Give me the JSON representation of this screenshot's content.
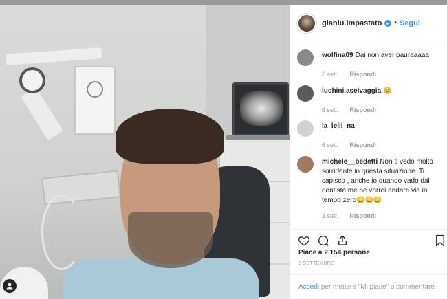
{
  "post": {
    "owner": "gianlu.impastato",
    "separator": "•",
    "follow_label": "Segui"
  },
  "comments": [
    {
      "user": "wolfina09",
      "text": "Dai non aver pauraaaaa",
      "time": "6 sett.",
      "reply": "Rispondi",
      "avatar_color": "#8a8a8a"
    },
    {
      "user": "luchini.aselvaggia",
      "text": "😊",
      "time": "6 sett.",
      "reply": "Rispondi",
      "avatar_color": "#5e5a56"
    },
    {
      "user": "la_lelli_na",
      "text": "",
      "time": "6 sett.",
      "reply": "Rispondi",
      "avatar_color": "#d8d0cc"
    },
    {
      "user": "michele__bedetti",
      "text": "Non ti vedo molto sorridente in questa situazione. Ti capisco , anche io quando vado dal dentista me ne vorrei andare via in tempo zero😄😄😄",
      "time": "3 sett.",
      "reply": "Rispondi",
      "avatar_color": "#a07a62"
    }
  ],
  "likes_text": "Piace a 2.154 persone",
  "date": "3 SETTEMBRE",
  "login": {
    "link": "Accedi",
    "rest": " per mettere \"Mi piace\" o commentare."
  },
  "icons": [
    "heart-icon",
    "comment-icon",
    "share-icon",
    "bookmark-icon",
    "verified-icon",
    "user-icon"
  ],
  "colors": {
    "accent": "#3897f0",
    "text": "#262626",
    "muted": "#999999"
  }
}
